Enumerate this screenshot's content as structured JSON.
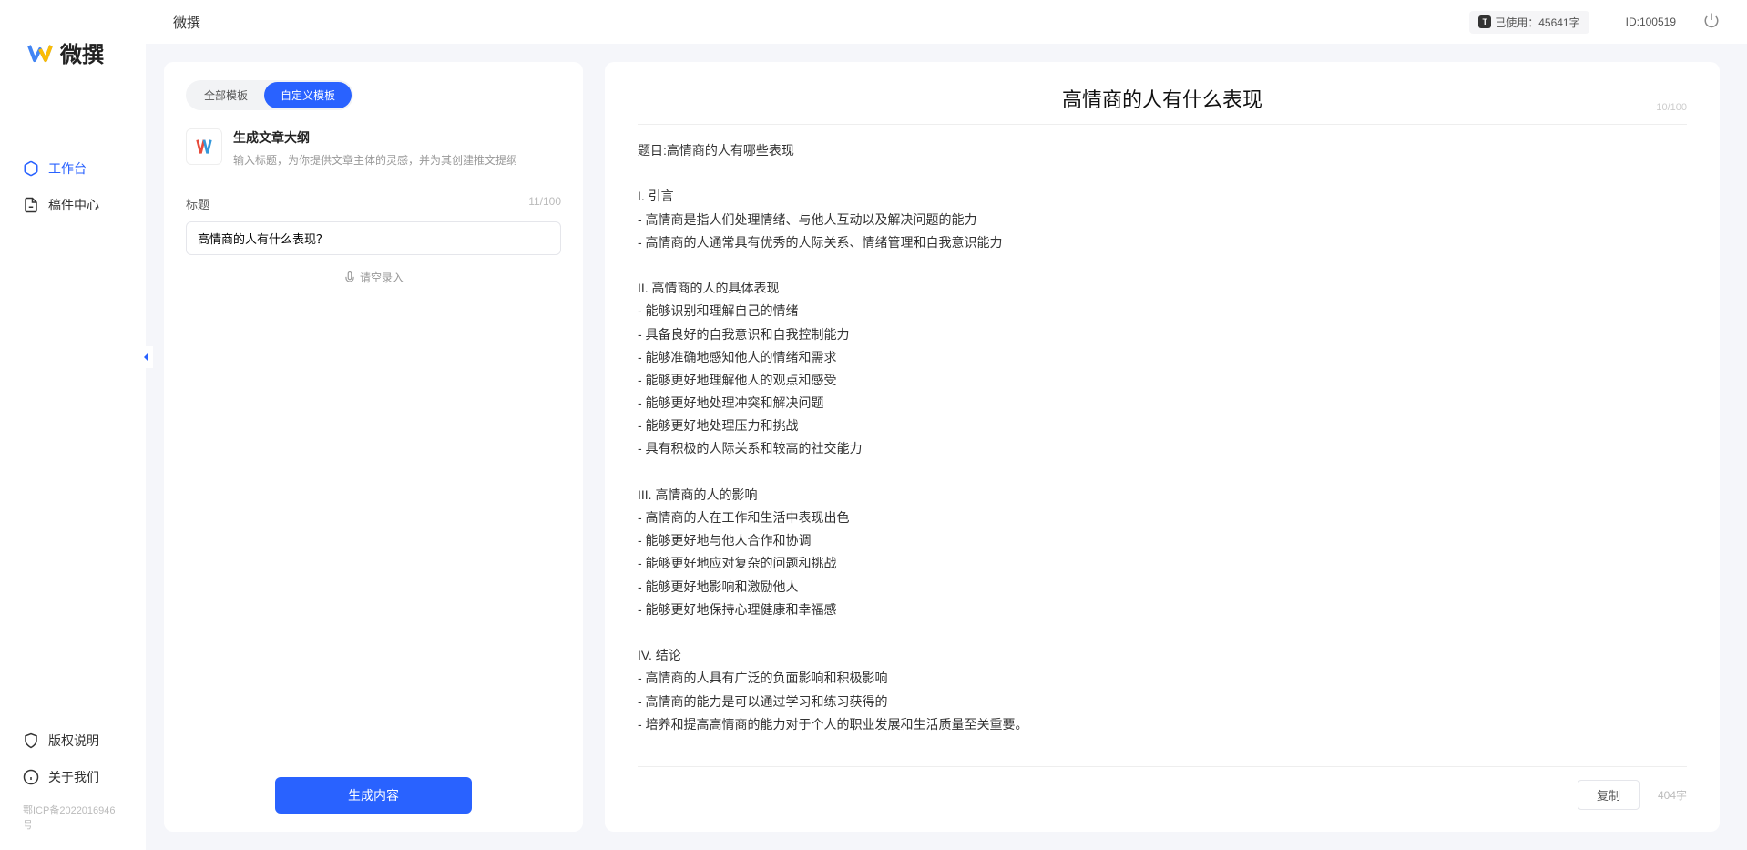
{
  "brand": "微撰",
  "header": {
    "title": "微撰",
    "usage_label": "已使用：45641字",
    "id_label": "ID:100519"
  },
  "sidebar": {
    "nav": [
      {
        "label": "工作台",
        "icon": "cube",
        "active": true
      },
      {
        "label": "稿件中心",
        "icon": "doc",
        "active": false
      }
    ],
    "bottom": [
      {
        "label": "版权说明",
        "icon": "shield"
      },
      {
        "label": "关于我们",
        "icon": "info"
      }
    ],
    "icp": "鄂ICP备2022016946号"
  },
  "left_panel": {
    "tabs": [
      {
        "label": "全部模板",
        "active": false
      },
      {
        "label": "自定义模板",
        "active": true
      }
    ],
    "template": {
      "title": "生成文章大纲",
      "desc": "输入标题，为你提供文章主体的灵感，并为其创建推文提纲"
    },
    "title_field": {
      "label": "标题",
      "count": "11/100",
      "value": "高情商的人有什么表现？"
    },
    "voice_label": "请空录入",
    "generate_btn": "生成内容"
  },
  "right_panel": {
    "title": "高情商的人有什么表现",
    "title_count": "10/100",
    "body": "题目:高情商的人有哪些表现\n\nI. 引言\n- 高情商是指人们处理情绪、与他人互动以及解决问题的能力\n- 高情商的人通常具有优秀的人际关系、情绪管理和自我意识能力\n\nII. 高情商的人的具体表现\n- 能够识别和理解自己的情绪\n- 具备良好的自我意识和自我控制能力\n- 能够准确地感知他人的情绪和需求\n- 能够更好地理解他人的观点和感受\n- 能够更好地处理冲突和解决问题\n- 能够更好地处理压力和挑战\n- 具有积极的人际关系和较高的社交能力\n\nIII. 高情商的人的影响\n- 高情商的人在工作和生活中表现出色\n- 能够更好地与他人合作和协调\n- 能够更好地应对复杂的问题和挑战\n- 能够更好地影响和激励他人\n- 能够更好地保持心理健康和幸福感\n\nIV. 结论\n- 高情商的人具有广泛的负面影响和积极影响\n- 高情商的能力是可以通过学习和练习获得的\n- 培养和提高高情商的能力对于个人的职业发展和生活质量至关重要。",
    "copy_btn": "复制",
    "char_count": "404字"
  }
}
